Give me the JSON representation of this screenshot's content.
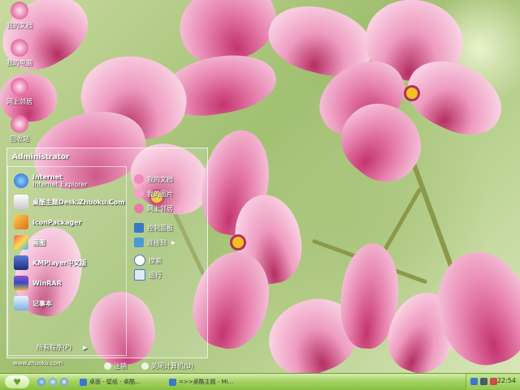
{
  "desktop_icons": [
    {
      "label": "我的文档",
      "icon": "my-documents-icon"
    },
    {
      "label": "我的电脑",
      "icon": "my-computer-icon"
    },
    {
      "label": "网上邻居",
      "icon": "network-icon"
    },
    {
      "label": "回收站",
      "icon": "recycle-bin-icon"
    }
  ],
  "start_menu": {
    "user": "Administrator",
    "pinned": [
      {
        "title": "Internet",
        "subtitle": "Internet Explorer",
        "icon": "internet-explorer-icon"
      }
    ],
    "recent": [
      {
        "label": "桌酷主题Desk.Zhuoku.Com",
        "icon": "zhuoku-theme-icon"
      },
      {
        "label": "IconPackager",
        "icon": "iconpackager-icon"
      },
      {
        "label": "画图",
        "icon": "paint-icon"
      },
      {
        "label": "KMPlayer中文版",
        "icon": "kmplayer-icon"
      },
      {
        "label": "WinRAR",
        "icon": "winrar-icon"
      },
      {
        "label": "记事本",
        "icon": "notepad-icon"
      }
    ],
    "right_items": [
      {
        "label": "我的文档",
        "icon": "documents-icon"
      },
      {
        "label": "我的图片",
        "icon": "pictures-icon"
      },
      {
        "label": "网上邻居",
        "icon": "network-places-icon"
      },
      {
        "label": "控制面板",
        "icon": "control-panel-icon"
      },
      {
        "label": "连接到",
        "icon": "connect-to-icon"
      },
      {
        "label": "搜索",
        "icon": "search-icon"
      },
      {
        "label": "运行",
        "icon": "run-icon"
      }
    ],
    "all_programs": "所有程序(P)",
    "log_off": "注销",
    "shut_down": "关闭计算机(U)"
  },
  "watermark": "www.zhuoku.com",
  "taskbar": {
    "tasks": [
      {
        "label": "桌面 - 壁纸 - 桌酷..."
      },
      {
        "label": "=>>桌酷主题 - Mi..."
      }
    ],
    "clock": "22:54"
  },
  "colors": {
    "taskbar": "#a9d56a",
    "accent": "#e36aa0"
  }
}
